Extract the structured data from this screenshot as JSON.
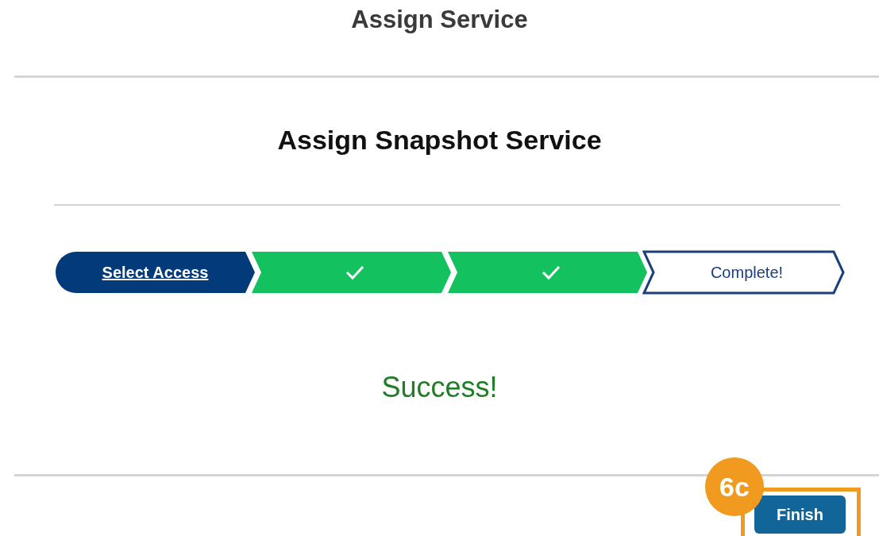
{
  "page_title": "Assign Service",
  "dialog": {
    "title": "Assign Snapshot Service",
    "steps": [
      {
        "kind": "link",
        "label": "Select Access"
      },
      {
        "kind": "done"
      },
      {
        "kind": "done"
      },
      {
        "kind": "current",
        "label": "Complete!"
      }
    ],
    "message": "Success!",
    "finish_button": "Finish"
  },
  "annotation": {
    "badge": "6c"
  }
}
